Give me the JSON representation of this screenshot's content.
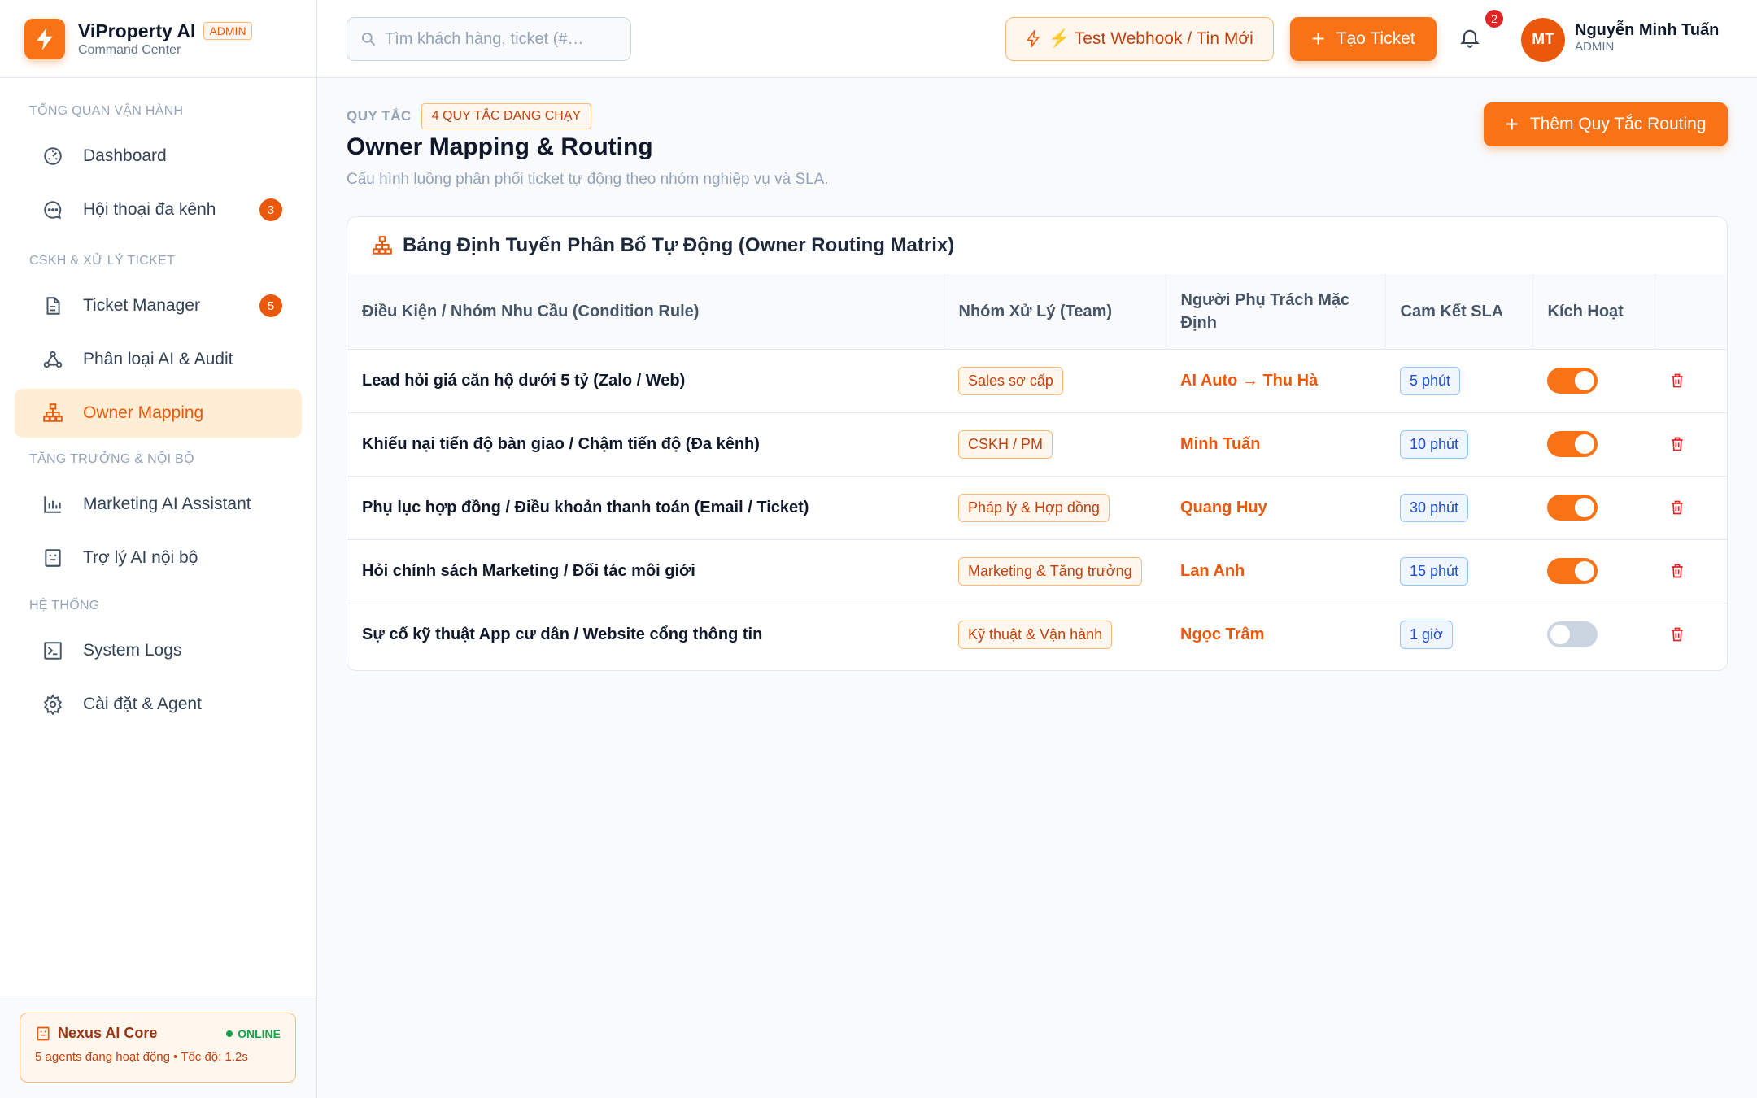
{
  "brand": {
    "name": "ViProperty AI",
    "badge": "ADMIN",
    "subtitle": "Command Center"
  },
  "sidebar": {
    "sections": [
      {
        "title": "TỔNG QUAN VẬN HÀNH"
      },
      {
        "title": "CSKH & XỬ LÝ TICKET"
      },
      {
        "title": "TĂNG TRƯỞNG & NỘI BỘ"
      },
      {
        "title": "HỆ THỐNG"
      }
    ],
    "items": [
      {
        "label": "Dashboard",
        "icon": "gauge-icon"
      },
      {
        "label": "Hội thoại đa kênh",
        "icon": "chat-icon",
        "count": "3"
      },
      {
        "label": "Ticket Manager",
        "icon": "document-icon",
        "count": "5"
      },
      {
        "label": "Phân loại AI & Audit",
        "icon": "network-icon"
      },
      {
        "label": "Owner Mapping",
        "icon": "hierarchy-icon",
        "active": true
      },
      {
        "label": "Marketing AI Assistant",
        "icon": "bar-chart-icon"
      },
      {
        "label": "Trợ lý AI nội bộ",
        "icon": "robot-icon"
      },
      {
        "label": "System Logs",
        "icon": "terminal-icon"
      },
      {
        "label": "Cài đặt & Agent",
        "icon": "gear-icon"
      }
    ],
    "core": {
      "name": "Nexus AI Core",
      "status": "ONLINE",
      "description": "5 agents đang hoạt động • Tốc độ: 1.2s"
    }
  },
  "header": {
    "search_placeholder": "Tìm khách hàng, ticket (#…",
    "webhook_label": "⚡ Test Webhook / Tin Mới",
    "create_ticket_label": "Tạo Ticket",
    "notification_count": "2",
    "user": {
      "initials": "MT",
      "name": "Nguyễn Minh Tuấn",
      "role": "ADMIN"
    }
  },
  "page": {
    "crumb_label": "QUY TẮC",
    "rules_badge": "4 QUY TẮC ĐANG CHẠY",
    "title": "Owner Mapping & Routing",
    "subtitle": "Cấu hình luồng phân phối ticket tự động theo nhóm nghiệp vụ và SLA.",
    "add_rule_label": "Thêm Quy Tắc Routing"
  },
  "matrix": {
    "title": "Bảng Định Tuyến Phân Bổ Tự Động (Owner Routing Matrix)",
    "columns": [
      "Điều Kiện / Nhóm Nhu Cầu (Condition Rule)",
      "Nhóm Xử Lý (Team)",
      "Người Phụ Trách Mặc Định",
      "Cam Kết SLA",
      "Kích Hoạt",
      ""
    ],
    "rows": [
      {
        "condition": "Lead hỏi giá căn hộ dưới 5 tỷ (Zalo / Web)",
        "team": "Sales sơ cấp",
        "owner": "AI Auto → Thu Hà",
        "sla": "5 phút",
        "active": true
      },
      {
        "condition": "Khiếu nại tiến độ bàn giao / Chậm tiến độ (Đa kênh)",
        "team": "CSKH / PM",
        "owner": "Minh Tuấn",
        "sla": "10 phút",
        "active": true
      },
      {
        "condition": "Phụ lục hợp đồng / Điều khoản thanh toán (Email / Ticket)",
        "team": "Pháp lý & Hợp đồng",
        "owner": "Quang Huy",
        "sla": "30 phút",
        "active": true
      },
      {
        "condition": "Hỏi chính sách Marketing / Đối tác môi giới",
        "team": "Marketing & Tăng trưởng",
        "owner": "Lan Anh",
        "sla": "15 phút",
        "active": true
      },
      {
        "condition": "Sự cố kỹ thuật App cư dân / Website cổng thông tin",
        "team": "Kỹ thuật & Vận hành",
        "owner": "Ngọc Trâm",
        "sla": "1 giờ",
        "active": false
      }
    ]
  }
}
